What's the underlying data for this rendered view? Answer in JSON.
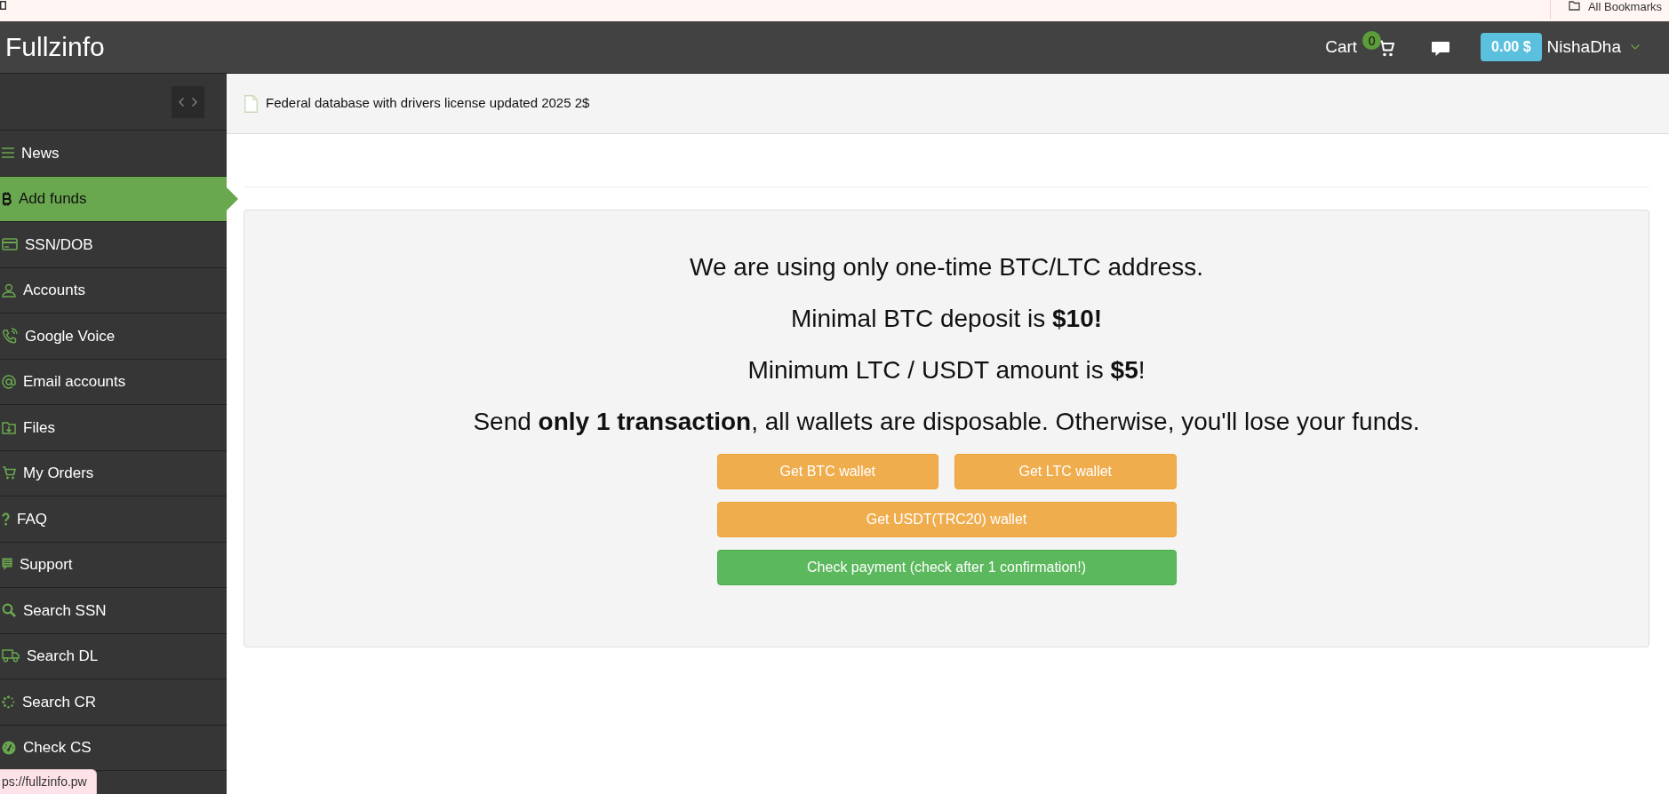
{
  "bookmarks_bar": {
    "label": "All Bookmarks"
  },
  "navbar": {
    "logo": "Fullzinfo",
    "cart": {
      "label": "Cart",
      "count": "0"
    },
    "balance": "0.00 $",
    "username": "NishaDha"
  },
  "sidebar": {
    "items": [
      {
        "label": "News",
        "selected": false
      },
      {
        "label": "Add funds",
        "selected": true
      },
      {
        "label": "SSN/DOB",
        "selected": false
      },
      {
        "label": "Accounts",
        "selected": false
      },
      {
        "label": "Google Voice",
        "selected": false
      },
      {
        "label": "Email accounts",
        "selected": false
      },
      {
        "label": "Files",
        "selected": false
      },
      {
        "label": "My Orders",
        "selected": false
      },
      {
        "label": "FAQ",
        "selected": false
      },
      {
        "label": "Support",
        "selected": false
      },
      {
        "label": "Search SSN",
        "selected": false
      },
      {
        "label": "Search DL",
        "selected": false
      },
      {
        "label": "Search CR",
        "selected": false
      },
      {
        "label": "Check CS",
        "selected": false
      }
    ]
  },
  "notice": {
    "text": "Federal database with drivers license updated 2025 2$"
  },
  "deposit_panel": {
    "lines": [
      "We are using only one-time BTC/LTC address.",
      "Minimal BTC deposit is **$10!**",
      "Minimum LTC / USDT amount is **$5**!",
      "Send **only 1 transaction**, all wallets are disposable. Otherwise, you'll lose your funds."
    ],
    "button_rows": [
      [
        {
          "label": "Get BTC wallet",
          "kind": "warning"
        },
        {
          "label": "Get LTC wallet",
          "kind": "warning"
        }
      ],
      [
        {
          "label": "Get USDT(TRC20) wallet",
          "kind": "warning"
        }
      ],
      [
        {
          "label": "Check payment (check after 1 confirmation!)",
          "kind": "success"
        }
      ]
    ]
  },
  "status_bubble": {
    "url": "ps://fullzinfo.pw"
  }
}
